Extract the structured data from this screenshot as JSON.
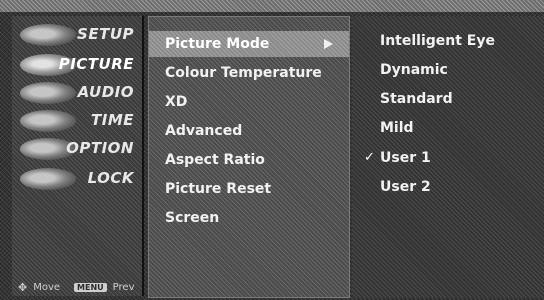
{
  "categories": [
    {
      "label": "SETUP",
      "icon": "satellite-dish-icon"
    },
    {
      "label": "PICTURE",
      "icon": "picture-icon",
      "active": true
    },
    {
      "label": "AUDIO",
      "icon": "speaker-icon"
    },
    {
      "label": "TIME",
      "icon": "clock-icon"
    },
    {
      "label": "OPTION",
      "icon": "option-icon"
    },
    {
      "label": "LOCK",
      "icon": "padlock-icon"
    }
  ],
  "hints": {
    "move_label": "Move",
    "menu_key": "MENU",
    "prev_label": "Prev"
  },
  "menu": {
    "items": [
      {
        "label": "Picture Mode",
        "selected": true
      },
      {
        "label": "Colour Temperature"
      },
      {
        "label": "XD"
      },
      {
        "label": "Advanced"
      },
      {
        "label": "Aspect Ratio"
      },
      {
        "label": "Picture Reset"
      },
      {
        "label": "Screen"
      }
    ]
  },
  "submenu": {
    "items": [
      {
        "label": "Intelligent Eye"
      },
      {
        "label": "Dynamic"
      },
      {
        "label": "Standard"
      },
      {
        "label": "Mild"
      },
      {
        "label": "User 1",
        "checked": true
      },
      {
        "label": "User 2"
      }
    ],
    "check_mark": "✓"
  }
}
